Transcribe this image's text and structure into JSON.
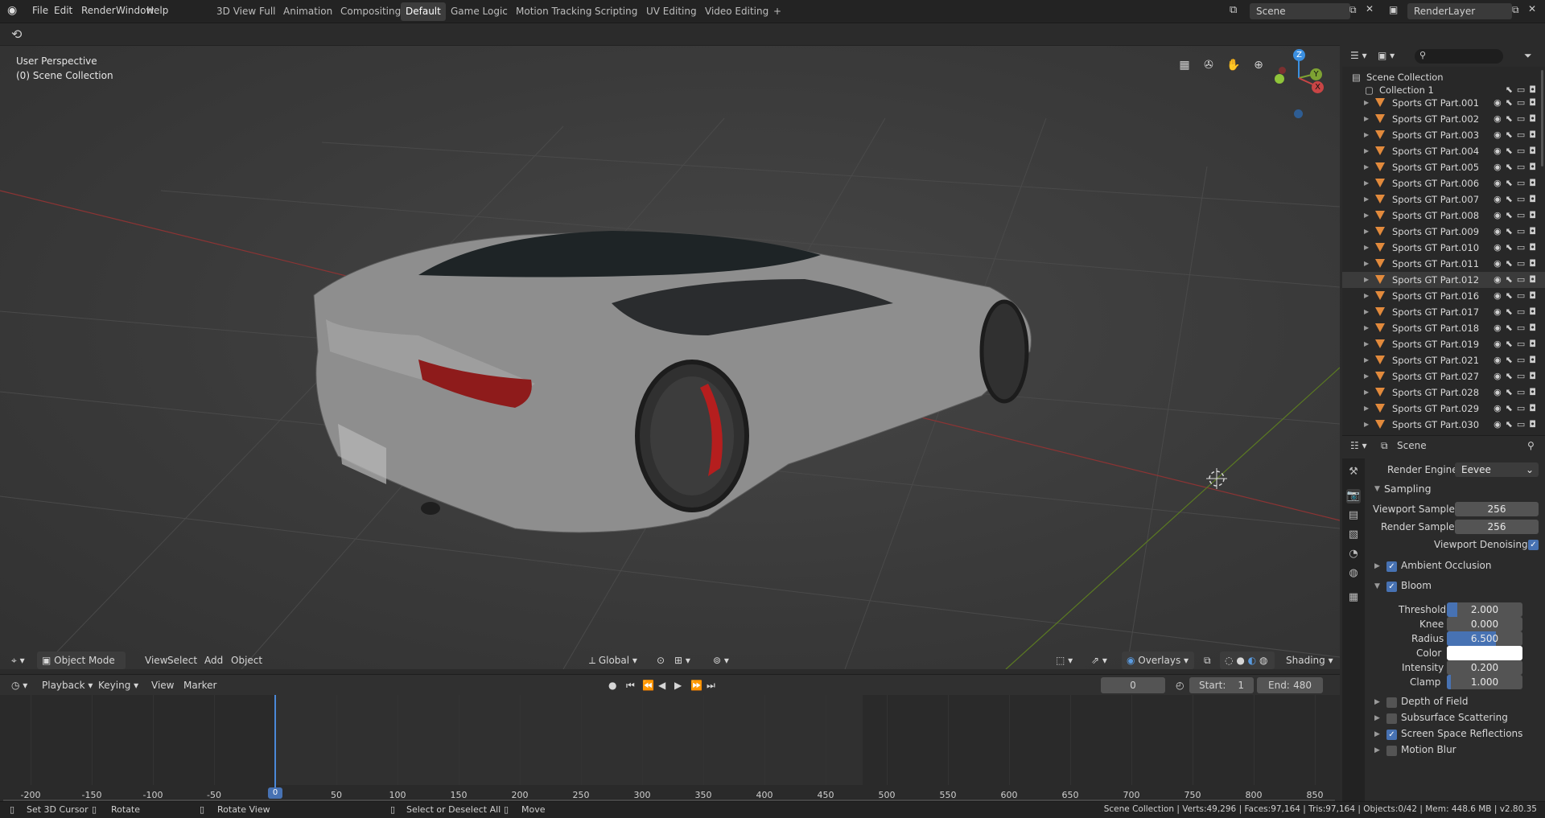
{
  "topbar": {
    "menus": [
      "File",
      "Edit",
      "Render",
      "Window",
      "Help"
    ],
    "workspaces": [
      "3D View Full",
      "Animation",
      "Compositing",
      "Default",
      "Game Logic",
      "Motion Tracking",
      "Scripting",
      "UV Editing",
      "Video Editing"
    ],
    "active_workspace": "Default",
    "add_tab": "+",
    "scene_name": "Scene",
    "render_layer": "RenderLayer"
  },
  "viewport": {
    "perspective": "User Perspective",
    "collection": "(0) Scene Collection",
    "gizmo_z": "Z",
    "gizmo_y": "Y",
    "gizmo_x": "X"
  },
  "viewport_header": {
    "mode": "Object Mode",
    "menus": [
      "View",
      "Select",
      "Add",
      "Object"
    ],
    "transform": "Global",
    "overlays": "Overlays",
    "shading": "Shading"
  },
  "timeline": {
    "menus": [
      "Playback",
      "Keying",
      "View",
      "Marker"
    ],
    "current_frame": "0",
    "start_label": "Start:",
    "start": "1",
    "end_label": "End:",
    "end": "480",
    "ticks": [
      "-200",
      "-150",
      "-100",
      "-50",
      "0",
      "50",
      "100",
      "150",
      "200",
      "250",
      "300",
      "350",
      "400",
      "450",
      "500",
      "550",
      "600",
      "650",
      "700",
      "750",
      "800",
      "850"
    ],
    "playhead_label": "0"
  },
  "statusbar": {
    "set_cursor": "Set 3D Cursor",
    "rotate": "Rotate",
    "rotate_view": "Rotate View",
    "select": "Select or Deselect All",
    "move": "Move",
    "stats": "Scene Collection | Verts:49,296 | Faces:97,164 | Tris:97,164 | Objects:0/42 | Mem: 448.6 MB | v2.80.35"
  },
  "outliner": {
    "root": "Scene Collection",
    "collection": "Collection 1",
    "items": [
      "Sports GT Part.001",
      "Sports GT Part.002",
      "Sports GT Part.003",
      "Sports GT Part.004",
      "Sports GT Part.005",
      "Sports GT Part.006",
      "Sports GT Part.007",
      "Sports GT Part.008",
      "Sports GT Part.009",
      "Sports GT Part.010",
      "Sports GT Part.011",
      "Sports GT Part.012",
      "Sports GT Part.016",
      "Sports GT Part.017",
      "Sports GT Part.018",
      "Sports GT Part.019",
      "Sports GT Part.021",
      "Sports GT Part.027",
      "Sports GT Part.028",
      "Sports GT Part.029",
      "Sports GT Part.030"
    ],
    "selected_index": 11
  },
  "properties": {
    "context": "Scene",
    "render_engine_label": "Render Engine",
    "render_engine": "Eevee",
    "sampling": "Sampling",
    "viewport_samples_label": "Viewport Samples",
    "viewport_samples": "256",
    "render_samples_label": "Render Samples",
    "render_samples": "256",
    "viewport_denoising": "Viewport Denoising",
    "ambient_occlusion": "Ambient Occlusion",
    "bloom": "Bloom",
    "threshold_label": "Threshold",
    "threshold": "2.000",
    "knee_label": "Knee",
    "knee": "0.000",
    "radius_label": "Radius",
    "radius": "6.500",
    "color_label": "Color",
    "intensity_label": "Intensity",
    "intensity": "0.200",
    "clamp_label": "Clamp",
    "clamp": "1.000",
    "depth_of_field": "Depth of Field",
    "subsurface": "Subsurface Scattering",
    "ssr": "Screen Space Reflections",
    "motion_blur": "Motion Blur"
  },
  "colors": {
    "accent": "#4772b3",
    "object_icon": "#e28a3c",
    "x_axis": "#c94545",
    "y_axis": "#7ea233",
    "z_axis": "#3b8fe0"
  }
}
